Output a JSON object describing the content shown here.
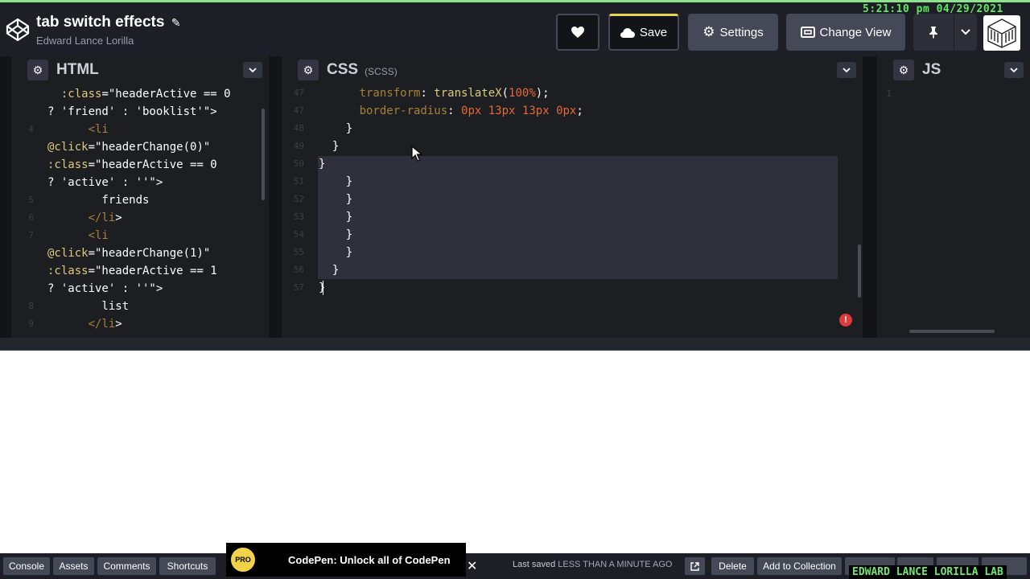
{
  "clock": "5:21:10 pm 04/29/2021",
  "header": {
    "title": "tab switch effects",
    "author": "Edward Lance Lorilla",
    "save_label": "Save",
    "settings_label": "Settings",
    "change_view_label": "Change View"
  },
  "html_panel": {
    "name": "HTML",
    "lines": [
      {
        "n": "",
        "text": "  :class=\"headerActive == 0"
      },
      {
        "n": "",
        "text": "? 'friend' : 'booklist'\">"
      },
      {
        "n": "4",
        "text": "      <li"
      },
      {
        "n": "",
        "text": "@click=\"headerChange(0)\""
      },
      {
        "n": "",
        "text": ":class=\"headerActive == 0"
      },
      {
        "n": "",
        "text": "? 'active' : ''\">"
      },
      {
        "n": "5",
        "text": "        friends"
      },
      {
        "n": "6",
        "text": "      </li>"
      },
      {
        "n": "7",
        "text": "      <li"
      },
      {
        "n": "",
        "text": "@click=\"headerChange(1)\""
      },
      {
        "n": "",
        "text": ":class=\"headerActive == 1"
      },
      {
        "n": "",
        "text": "? 'active' : ''\">"
      },
      {
        "n": "8",
        "text": "        list"
      },
      {
        "n": "9",
        "text": "      </li>"
      }
    ]
  },
  "css_panel": {
    "name": "CSS",
    "sub": "(SCSS)",
    "lines": [
      {
        "n": "47",
        "text": "      transform: translateX(100%);"
      },
      {
        "n": "47",
        "text": "      border-radius: 0px 13px 13px 0px;"
      },
      {
        "n": "48",
        "text": "    }"
      },
      {
        "n": "49",
        "text": "  }"
      },
      {
        "n": "50",
        "text": "}"
      },
      {
        "n": "51",
        "text": "    }"
      },
      {
        "n": "52",
        "text": "    }"
      },
      {
        "n": "53",
        "text": "    }"
      },
      {
        "n": "54",
        "text": "    }"
      },
      {
        "n": "55",
        "text": "    }"
      },
      {
        "n": "56",
        "text": "  }"
      },
      {
        "n": "57",
        "text": "}"
      }
    ]
  },
  "js_panel": {
    "name": "JS",
    "lines": [
      {
        "n": "1",
        "text": ""
      }
    ]
  },
  "bottom": {
    "console": "Console",
    "assets": "Assets",
    "comments": "Comments",
    "shortcuts": "Shortcuts",
    "promo_badge": "PRO",
    "promo_text": "CodePen: Unlock all of CodePen",
    "last_saved_prefix": "Last saved",
    "last_saved_value": "LESS THAN A MINUTE AGO",
    "delete": "Delete",
    "add_to_collection": "Add to Collection"
  },
  "watermark": "EDWARD LANCE LORILLA LAB",
  "icons": [
    "codepen-logo-icon",
    "pencil-icon",
    "heart-icon",
    "cloud-icon",
    "gear-icon",
    "change-view-icon",
    "pin-icon",
    "chevron-down-icon",
    "error-icon",
    "external-link-icon",
    "close-icon"
  ]
}
